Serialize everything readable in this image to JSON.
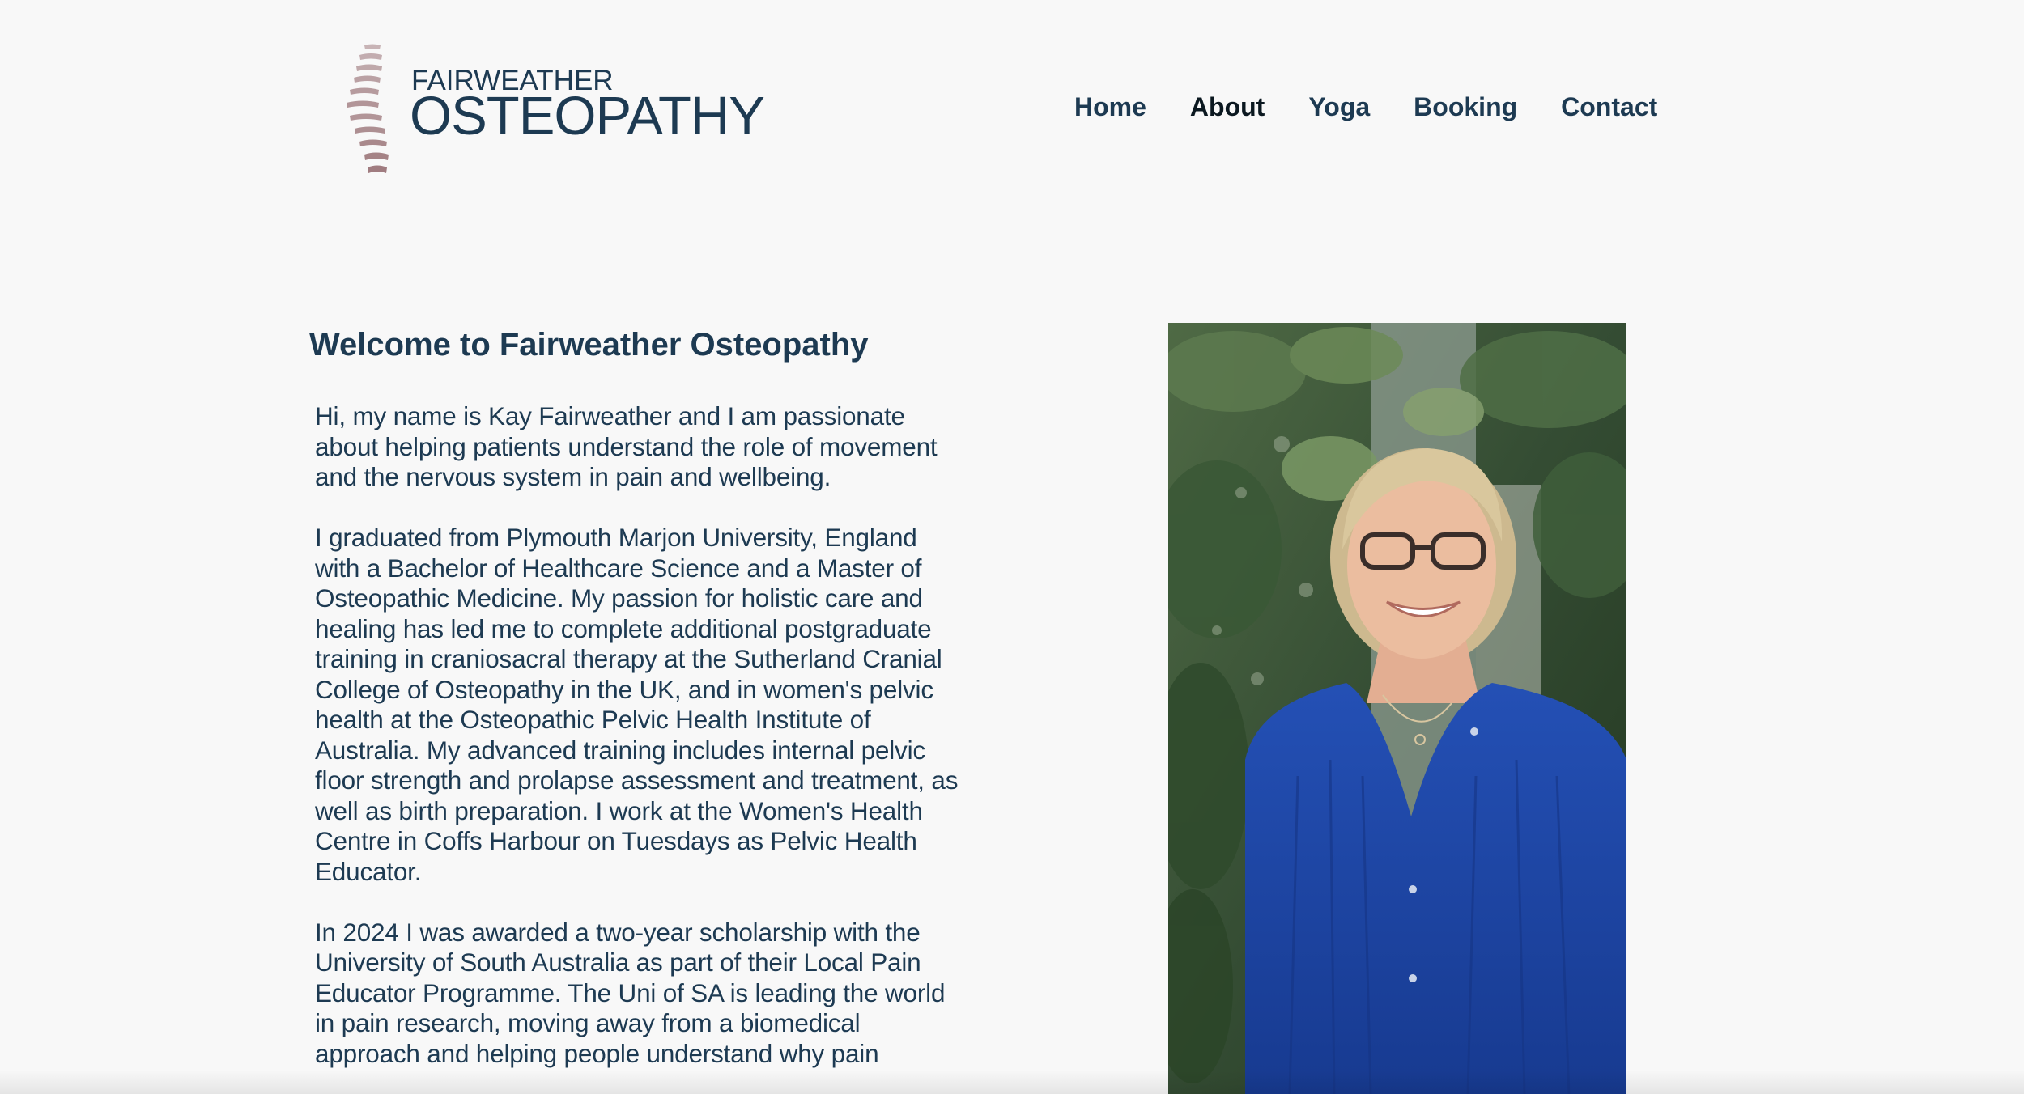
{
  "brand": {
    "line1": "FAIRWEATHER",
    "line2": "OSTEOPATHY",
    "icon": "spine-logo-icon",
    "colors": {
      "text": "#1d3a52",
      "mark": "#a07c80"
    }
  },
  "nav": {
    "items": [
      {
        "label": "Home",
        "active": false
      },
      {
        "label": "About",
        "active": true
      },
      {
        "label": "Yoga",
        "active": false
      },
      {
        "label": "Booking",
        "active": false
      },
      {
        "label": "Contact",
        "active": false
      }
    ]
  },
  "main": {
    "title": "Welcome to Fairweather Osteopathy",
    "paragraphs": [
      "Hi, my name is Kay Fairweather and I am passionate about helping patients understand the role of movement and the nervous system in pain and wellbeing.",
      "I graduated from Plymouth Marjon University, England with a Bachelor of Healthcare Science and a Master of Osteopathic Medicine. My passion for holistic care and healing has led me to complete additional postgraduate training in craniosacral therapy at the Sutherland Cranial College of Osteopathy in the UK, and in women's pelvic health at the Osteopathic Pelvic Health Institute of Australia. My advanced training includes internal pelvic floor strength and prolapse assessment and treatment, as well as birth preparation. I work at the Women's Health Centre in Coffs Harbour on Tuesdays as Pelvic Health Educator.",
      "In 2024 I was awarded a two-year scholarship with the University of South Australia as part of their Local Pain Educator Programme. The Uni of SA is leading the world in pain research, moving away from a biomedical approach and helping people understand why pain"
    ]
  },
  "photo": {
    "subject": "portrait-photo",
    "colors": {
      "foliage": "#3d5a3a",
      "shirt": "#1f47a8",
      "hair": "#d8c49a",
      "skin": "#e8b89a"
    }
  }
}
